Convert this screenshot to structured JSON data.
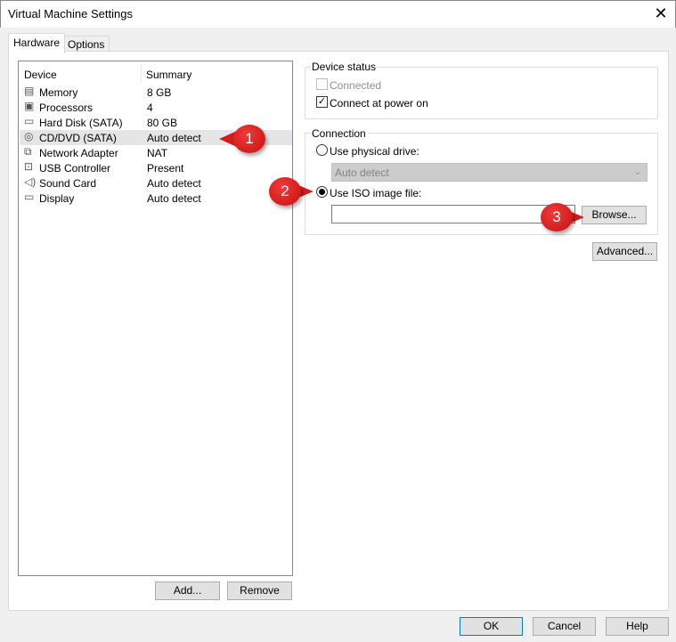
{
  "window": {
    "title": "Virtual Machine Settings",
    "close_icon": "close-icon"
  },
  "tabs": [
    {
      "label": "Hardware",
      "active": true
    },
    {
      "label": "Options",
      "active": false
    }
  ],
  "device_list": {
    "headers": [
      "Device",
      "Summary"
    ],
    "rows": [
      {
        "icon": "memory-icon",
        "device": "Memory",
        "summary": "8 GB"
      },
      {
        "icon": "processor-icon",
        "device": "Processors",
        "summary": "4"
      },
      {
        "icon": "hard-disk-icon",
        "device": "Hard Disk (SATA)",
        "summary": "80 GB"
      },
      {
        "icon": "cd-dvd-icon",
        "device": "CD/DVD (SATA)",
        "summary": "Auto detect",
        "selected": true
      },
      {
        "icon": "network-adapter-icon",
        "device": "Network Adapter",
        "summary": "NAT"
      },
      {
        "icon": "usb-icon",
        "device": "USB Controller",
        "summary": "Present"
      },
      {
        "icon": "sound-icon",
        "device": "Sound Card",
        "summary": "Auto detect"
      },
      {
        "icon": "display-icon",
        "device": "Display",
        "summary": "Auto detect"
      }
    ]
  },
  "list_buttons": {
    "add": "Add...",
    "remove": "Remove"
  },
  "device_status": {
    "legend": "Device status",
    "connected": {
      "label": "Connected",
      "checked": false,
      "disabled": true
    },
    "connect_at_power_on": {
      "label": "Connect at power on",
      "checked": true
    }
  },
  "connection": {
    "legend": "Connection",
    "physical": {
      "label": "Use physical drive:",
      "selected": false
    },
    "physical_drive_value": "Auto detect",
    "iso": {
      "label": "Use ISO image file:",
      "selected": true
    },
    "iso_path": "",
    "browse": "Browse..."
  },
  "advanced": "Advanced...",
  "footer": {
    "ok": "OK",
    "cancel": "Cancel",
    "help": "Help"
  },
  "callouts": [
    "1",
    "2",
    "3"
  ],
  "accent": "#0078d7",
  "callout_color": "#d71a1a"
}
